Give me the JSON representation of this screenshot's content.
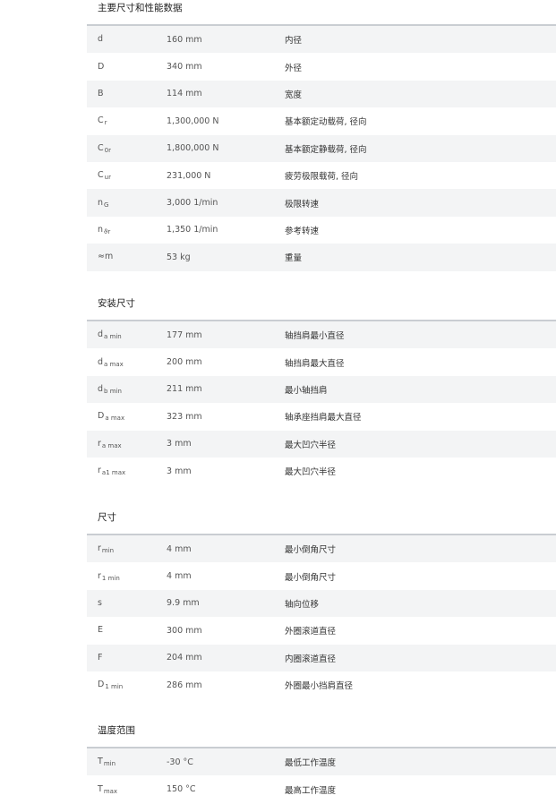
{
  "sections": [
    {
      "title": "主要尺寸和性能数据",
      "rows": [
        {
          "sym": "d",
          "sub": "",
          "val": "160 mm",
          "desc": "内径"
        },
        {
          "sym": "D",
          "sub": "",
          "val": "340 mm",
          "desc": "外径"
        },
        {
          "sym": "B",
          "sub": "",
          "val": "114 mm",
          "desc": "宽度"
        },
        {
          "sym": "C",
          "sub": "r",
          "val": "1,300,000 N",
          "desc": "基本额定动载荷, 径向"
        },
        {
          "sym": "C",
          "sub": "0r",
          "val": "1,800,000 N",
          "desc": "基本额定静载荷, 径向"
        },
        {
          "sym": "C",
          "sub": "ur",
          "val": "231,000 N",
          "desc": "疲劳极限载荷, 径向"
        },
        {
          "sym": "n",
          "sub": "G",
          "val": "3,000 1/min",
          "desc": "极限转速"
        },
        {
          "sym": "n",
          "sub": "ϑr",
          "val": "1,350 1/min",
          "desc": "参考转速"
        },
        {
          "sym": "≈m",
          "sub": "",
          "val": "53 kg",
          "desc": "重量"
        }
      ]
    },
    {
      "title": "安装尺寸",
      "rows": [
        {
          "sym": "d",
          "sub": "a min",
          "val": "177 mm",
          "desc": "轴挡肩最小直径"
        },
        {
          "sym": "d",
          "sub": "a max",
          "val": "200 mm",
          "desc": "轴挡肩最大直径"
        },
        {
          "sym": "d",
          "sub": "b min",
          "val": "211 mm",
          "desc": "最小轴挡肩"
        },
        {
          "sym": "D",
          "sub": "a max",
          "val": "323 mm",
          "desc": "轴承座挡肩最大直径"
        },
        {
          "sym": "r",
          "sub": "a max",
          "val": "3 mm",
          "desc": "最大凹穴半径"
        },
        {
          "sym": "r",
          "sub": "a1 max",
          "val": "3 mm",
          "desc": "最大凹穴半径"
        }
      ]
    },
    {
      "title": "尺寸",
      "rows": [
        {
          "sym": "r",
          "sub": "min",
          "val": "4 mm",
          "desc": "最小倒角尺寸"
        },
        {
          "sym": "r",
          "sub": "1 min",
          "val": "4 mm",
          "desc": "最小倒角尺寸"
        },
        {
          "sym": "s",
          "sub": "",
          "val": "9.9 mm",
          "desc": "轴向位移"
        },
        {
          "sym": "E",
          "sub": "",
          "val": "300 mm",
          "desc": "外圈滚道直径"
        },
        {
          "sym": "F",
          "sub": "",
          "val": "204 mm",
          "desc": "内圈滚道直径"
        },
        {
          "sym": "D",
          "sub": "1 min",
          "val": "286 mm",
          "desc": "外圈最小挡肩直径"
        }
      ]
    },
    {
      "title": "温度范围",
      "rows": [
        {
          "sym": "T",
          "sub": "min",
          "val": "-30 °C",
          "desc": "最低工作温度"
        },
        {
          "sym": "T",
          "sub": "max",
          "val": "150 °C",
          "desc": "最高工作温度"
        }
      ]
    }
  ]
}
